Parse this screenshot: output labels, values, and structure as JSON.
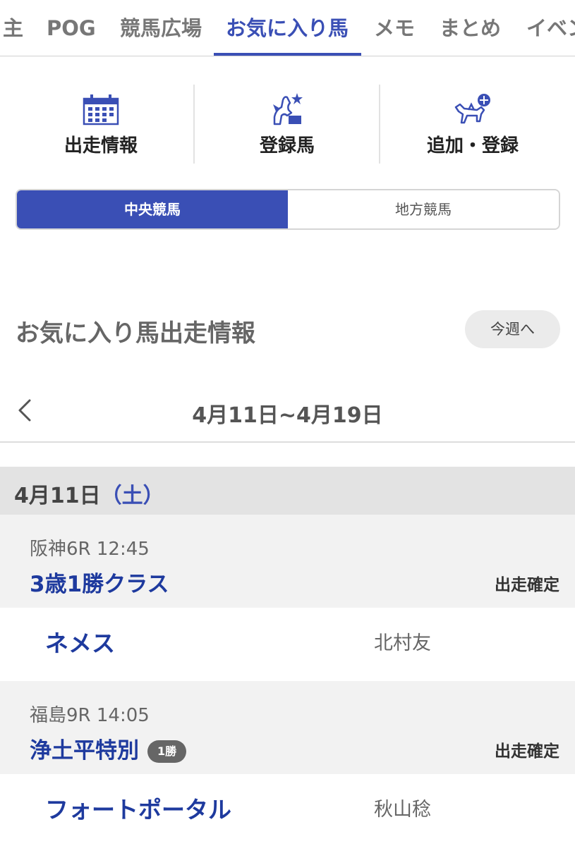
{
  "top_tabs": [
    {
      "label": "主"
    },
    {
      "label": "POG"
    },
    {
      "label": "競馬広場"
    },
    {
      "label": "お気に入り馬"
    },
    {
      "label": "メモ"
    },
    {
      "label": "まとめ"
    },
    {
      "label": "イベン"
    }
  ],
  "active_tab": "お気に入り馬",
  "icon_menu": [
    {
      "label": "出走情報",
      "icon": "calendar-icon"
    },
    {
      "label": "登録馬",
      "icon": "horse-trophy-icon"
    },
    {
      "label": "追加・登録",
      "icon": "horse-add-icon"
    }
  ],
  "segment": {
    "options": [
      "中央競馬",
      "地方競馬"
    ],
    "selected": "中央競馬"
  },
  "section": {
    "title": "お気に入り馬出走情報",
    "this_week_button": "今週へ"
  },
  "week_nav": {
    "range": "4月11日~4月19日",
    "prev_icon": "chevron-left-icon"
  },
  "day": {
    "date": "4月11日",
    "weekday": "（土）"
  },
  "races": [
    {
      "meta": "阪神6R 12:45",
      "name": "3歳1勝クラス",
      "grade": "",
      "status": "出走確定",
      "horse": "ネメス",
      "jockey": "北村友"
    },
    {
      "meta": "福島9R 14:05",
      "name": "浄土平特別",
      "grade": "1勝",
      "status": "出走確定",
      "horse": "フォートポータル",
      "jockey": "秋山稔"
    }
  ],
  "colors": {
    "accent": "#3a4fb5",
    "race_name": "#1e3a9e",
    "date_header_bg": "#e3e3e3",
    "race_header_bg": "#f2f2f2"
  }
}
